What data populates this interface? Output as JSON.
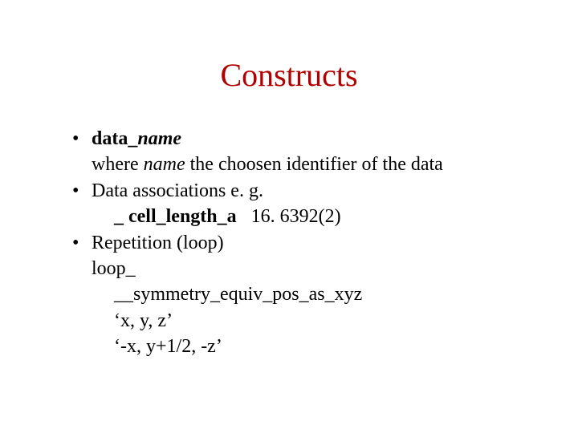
{
  "title": "Constructs",
  "bullets": {
    "b1": {
      "prefix": "data_",
      "name_ital": "name",
      "line2_a": "where ",
      "line2_name": "name",
      "line2_b": " the choosen identifier of the data"
    },
    "b2": {
      "line1": "Data associations e. g.",
      "line2_key": "_ cell_length_a",
      "line2_val": "   16. 6392(2)"
    },
    "b3": {
      "line1": "Repetition (loop)",
      "line2": "loop_",
      "line3": "__symmetry_equiv_pos_as_xyz",
      "line4": "‘x, y, z’",
      "line5": "‘-x, y+1/2, -z’"
    }
  }
}
